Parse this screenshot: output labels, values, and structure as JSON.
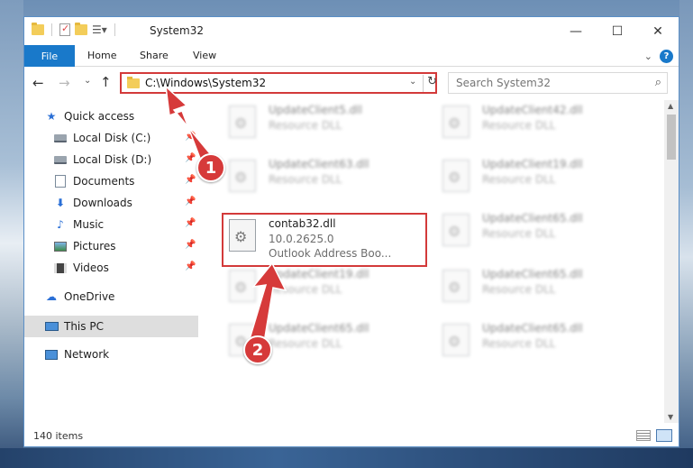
{
  "window": {
    "title": "System32",
    "controls": {
      "minimize": "—",
      "maximize": "☐",
      "close": "✕"
    }
  },
  "ribbon": {
    "file_tab": "File",
    "tabs": [
      "Home",
      "Share",
      "View"
    ],
    "expand_icon": "⌄",
    "help": "?"
  },
  "nav": {
    "back": "←",
    "forward": "→",
    "recent": "⌄",
    "up": "↑",
    "address": "C:\\Windows\\System32",
    "address_dropdown": "⌄",
    "refresh": "↻",
    "search_placeholder": "Search System32",
    "search_glyph": "⌕"
  },
  "sidebar": {
    "quick_access": "Quick access",
    "items": [
      {
        "label": "Local Disk (C:)",
        "icon": "disk-icon",
        "pinned": true
      },
      {
        "label": "Local Disk (D:)",
        "icon": "disk-icon",
        "pinned": true
      },
      {
        "label": "Documents",
        "icon": "documents-icon",
        "pinned": true
      },
      {
        "label": "Downloads",
        "icon": "downloads-icon",
        "pinned": true
      },
      {
        "label": "Music",
        "icon": "music-icon",
        "pinned": true
      },
      {
        "label": "Pictures",
        "icon": "pictures-icon",
        "pinned": true
      },
      {
        "label": "Videos",
        "icon": "videos-icon",
        "pinned": true
      }
    ],
    "onedrive": "OneDrive",
    "this_pc": "This PC",
    "network": "Network",
    "pin_glyph": "📌"
  },
  "files": {
    "left_column": [
      {
        "name": "UpdateClient5.dll",
        "line2": "Resource DLL",
        "line3": "",
        "blurred": true
      },
      {
        "name": "UpdateClient63.dll",
        "line2": "Resource DLL",
        "line3": "",
        "blurred": true
      },
      {
        "name": "contab32.dll",
        "line2": "10.0.2625.0",
        "line3": "Outlook Address Boo...",
        "blurred": false
      },
      {
        "name": "UpdateClient19.dll",
        "line2": "Resource DLL",
        "line3": "",
        "blurred": true
      },
      {
        "name": "UpdateClient65.dll",
        "line2": "Resource DLL",
        "line3": "",
        "blurred": true
      }
    ],
    "right_column": [
      {
        "name": "UpdateClient42.dll",
        "line2": "Resource DLL",
        "blurred": true
      },
      {
        "name": "UpdateClient19.dll",
        "line2": "Resource DLL",
        "blurred": true
      },
      {
        "name": "UpdateClient65.dll",
        "line2": "Resource DLL",
        "blurred": true
      },
      {
        "name": "UpdateClient65.dll",
        "line2": "Resource DLL",
        "blurred": true
      },
      {
        "name": "UpdateClient65.dll",
        "line2": "Resource DLL",
        "blurred": true
      }
    ]
  },
  "scrollbar": {
    "up": "▲",
    "down": "▼"
  },
  "status": {
    "item_count": "140 items"
  },
  "annotations": {
    "badge_1": "1",
    "badge_2": "2",
    "color": "#d33a3a"
  }
}
